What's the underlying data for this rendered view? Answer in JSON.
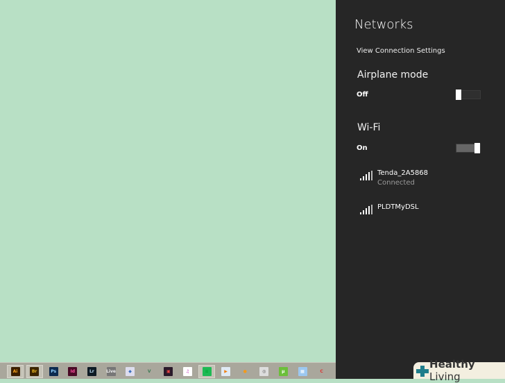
{
  "panel": {
    "title": "Networks",
    "view_settings": "View Connection Settings",
    "airplane": {
      "label": "Airplane mode",
      "state": "Off",
      "on": false
    },
    "wifi": {
      "label": "Wi-Fi",
      "state": "On",
      "on": true
    },
    "networks": [
      {
        "ssid": "Tenda_2A5868",
        "status": "Connected",
        "signal": 4
      },
      {
        "ssid": "PLDTMyDSL",
        "signal": 4
      }
    ]
  },
  "taskbar": {
    "apps": [
      {
        "name": "illustrator",
        "label": "Ai",
        "color": "#3b1f00",
        "fg": "#f7a21b",
        "active": true
      },
      {
        "name": "bridge",
        "label": "Br",
        "color": "#3b2400",
        "fg": "#e6b21e",
        "active": true
      },
      {
        "name": "photoshop",
        "label": "Ps",
        "color": "#0c2a4f",
        "fg": "#8fd0ff"
      },
      {
        "name": "indesign",
        "label": "Id",
        "color": "#4a0a26",
        "fg": "#ff4fa0"
      },
      {
        "name": "lightroom",
        "label": "Lr",
        "color": "#0d1a24",
        "fg": "#b5d8f0"
      },
      {
        "name": "live",
        "label": "Live",
        "color": "#777",
        "fg": "#eee"
      },
      {
        "name": "app-diamond",
        "label": "◆",
        "color": "#dde",
        "fg": "#3a6fc0"
      },
      {
        "name": "vectorizer",
        "label": "V",
        "color": "transparent",
        "fg": "#3d7a55"
      },
      {
        "name": "media-app",
        "label": "▣",
        "color": "#2a1a2a",
        "fg": "#e44"
      },
      {
        "name": "itunes",
        "label": "♫",
        "color": "#fff",
        "fg": "#c43fbe"
      },
      {
        "name": "spotify",
        "label": "≡",
        "color": "#1db954",
        "fg": "#0a3",
        "active": true
      },
      {
        "name": "media-player",
        "label": "▶",
        "color": "#e0eaf5",
        "fg": "#f08010"
      },
      {
        "name": "orange-app",
        "label": "●",
        "color": "transparent",
        "fg": "#f39a1a"
      },
      {
        "name": "disc-app",
        "label": "◎",
        "color": "#ddd",
        "fg": "#555"
      },
      {
        "name": "utorrent",
        "label": "µ",
        "color": "#6bbf3a",
        "fg": "#fff"
      },
      {
        "name": "calculator",
        "label": "▦",
        "color": "#9cc8f0",
        "fg": "#fff"
      },
      {
        "name": "ccleaner",
        "label": "C",
        "color": "transparent",
        "fg": "#d33"
      }
    ]
  },
  "watermark": {
    "brand_bold": "Healthy",
    "brand_rest": " Living"
  }
}
